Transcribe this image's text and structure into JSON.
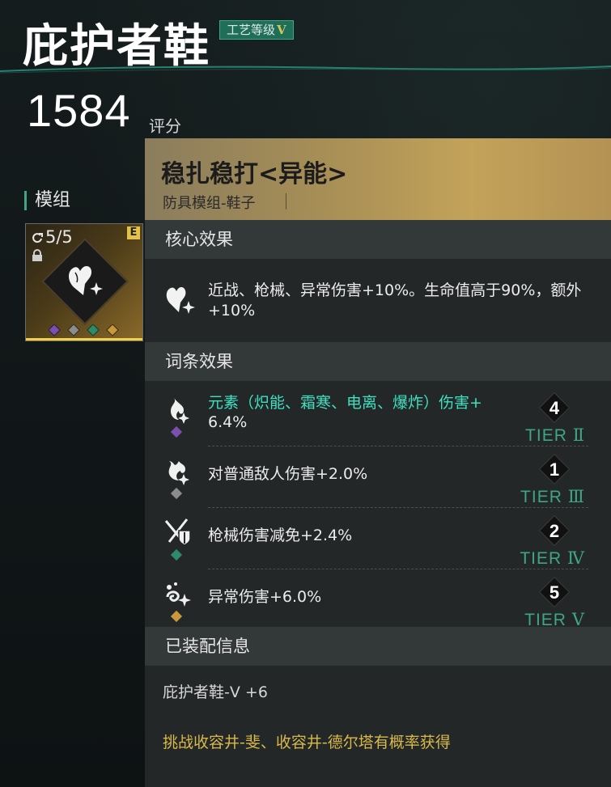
{
  "header": {
    "title": "庇护者鞋",
    "craft_badge": "工艺等级",
    "craft_level": "V",
    "score": "1584",
    "score_label": "评分"
  },
  "sidebar": {
    "section_label": "模组",
    "card": {
      "count": "5/5",
      "grade_badge": "E",
      "icon": "heart-star-icon",
      "gems": [
        "purple-diamond",
        "gray-diamond",
        "green-diamond",
        "gold-diamond"
      ]
    }
  },
  "panel": {
    "title": "稳扎稳打<异能>",
    "subtitle": "防具模组-鞋子",
    "core": {
      "heading": "核心效果",
      "icon": "heart-star-icon",
      "text": "近战、枪械、异常伤害+10%。生命值高于90%，额外+10%"
    },
    "affixes": {
      "heading": "词条效果",
      "items": [
        {
          "icon": "flame-star-icon",
          "gem": "#7a4fb0",
          "text_teal": "元素（炽能、霜寒、电离、爆炸）伤害+",
          "text_white": "6.4%",
          "tier_num": "4",
          "tier_prefix": "TIER",
          "tier_roman": "Ⅱ"
        },
        {
          "icon": "flame-burst-icon",
          "gem": "#8c8c8c",
          "text": "对普通敌人伤害+2.0%",
          "tier_num": "1",
          "tier_prefix": "TIER",
          "tier_roman": "Ⅲ"
        },
        {
          "icon": "sword-shield-icon",
          "gem": "#2f8a6a",
          "text": "枪械伤害减免+2.4%",
          "tier_num": "2",
          "tier_prefix": "TIER",
          "tier_roman": "Ⅳ"
        },
        {
          "icon": "swirl-star-icon",
          "gem": "#c8983a",
          "text": "异常伤害+6.0%",
          "tier_num": "5",
          "tier_prefix": "TIER",
          "tier_roman": "Ⅴ"
        }
      ]
    },
    "equip": {
      "heading": "已装配信息",
      "equipped_on": "庇护者鞋-Ⅴ +6",
      "source": "挑战收容井-斐、收容井-德尔塔有概率获得"
    }
  },
  "colors": {
    "accent_teal": "#3fa584",
    "affix_teal": "#3ee0c0",
    "gold": "#d8b94a"
  }
}
